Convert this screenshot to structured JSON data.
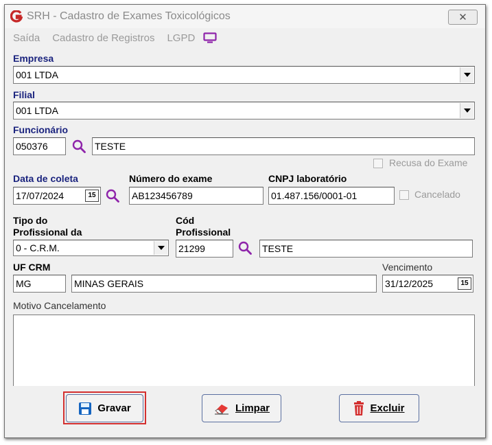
{
  "window": {
    "title": "SRH - Cadastro de Exames Toxicológicos",
    "close_glyph": "✕"
  },
  "menu": {
    "saida": "Saída",
    "cadastro": "Cadastro de Registros",
    "lgpd": "LGPD"
  },
  "form": {
    "empresa": {
      "label": "Empresa",
      "value": "001 LTDA"
    },
    "filial": {
      "label": "Filial",
      "value": "001 LTDA"
    },
    "funcionario": {
      "label": "Funcionário",
      "code": "050376",
      "name": "TESTE"
    },
    "recusa": {
      "label": "Recusa do Exame"
    },
    "data_coleta": {
      "label": "Data de coleta",
      "value": "17/07/2024"
    },
    "numero_exame": {
      "label": "Número do exame",
      "value": "AB123456789"
    },
    "cnpj": {
      "label": "CNPJ laboratório",
      "value": "01.487.156/0001-01"
    },
    "cancelado": {
      "label": "Cancelado"
    },
    "tipo_profissional": {
      "label_line1": "Tipo do",
      "label_line2": "Profissional da",
      "value": "0  - C.R.M."
    },
    "cod_profissional": {
      "label_line1": "Cód",
      "label_line2": "Profissional",
      "code": "21299",
      "name": "TESTE"
    },
    "uf_crm": {
      "label": "UF CRM",
      "uf": "MG",
      "estado": "MINAS GERAIS"
    },
    "vencimento": {
      "label": "Vencimento",
      "value": "31/12/2025"
    },
    "motivo": {
      "label": "Motivo Cancelamento",
      "value": ""
    },
    "calendar_glyph": "15"
  },
  "buttons": {
    "gravar": "Gravar",
    "limpar": "Limpar",
    "excluir": "Excluir"
  },
  "colors": {
    "label_blue": "#1a237e",
    "accent_purple": "#8e24aa",
    "focus_red": "#d32f2f",
    "logo_red": "#c62828"
  }
}
